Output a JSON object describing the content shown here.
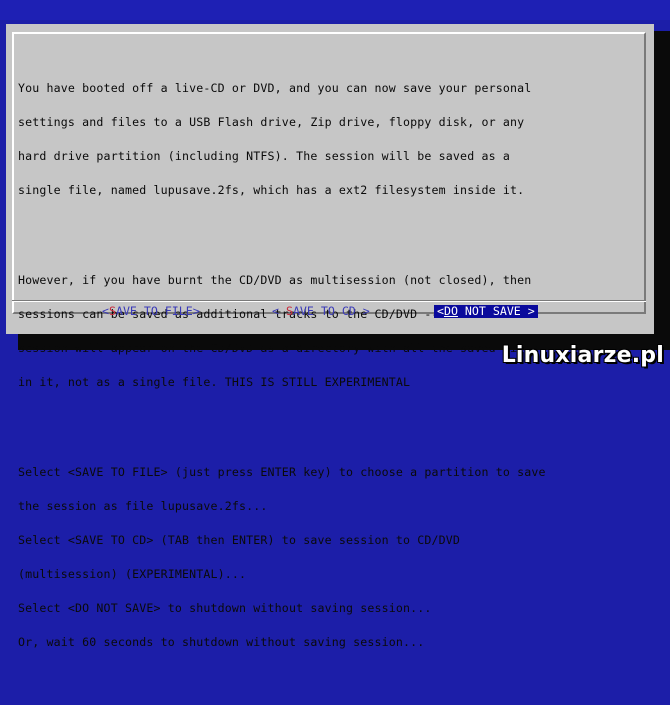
{
  "dialog": {
    "paragraphs": [
      [
        "You have booted off a live-CD or DVD, and you can now save your personal",
        "settings and files to a USB Flash drive, Zip drive, floppy disk, or any",
        "hard drive partition (including NTFS). The session will be saved as a",
        "single file, named lupusave.2fs, which has a ext2 filesystem inside it."
      ],
      [
        "However, if you have burnt the CD/DVD as multisession (not closed), then",
        "sessions can be saved as additional tracks to the CD/DVD -- each saved",
        "session will appear on the CD/DVD as a directory with all the saved files",
        "in it, not as a single file. THIS IS STILL EXPERIMENTAL"
      ],
      [
        "Select <SAVE TO FILE> (just press ENTER key) to choose a partition to save",
        "the session as file lupusave.2fs...",
        "Select <SAVE TO CD> (TAB then ENTER) to save session to CD/DVD",
        "(multisession) (EXPERIMENTAL)...",
        "Select <DO NOT SAVE> to shutdown without saving session...",
        "Or, wait 60 seconds to shutdown without saving session..."
      ]
    ],
    "buttons": {
      "save_to_file": {
        "open": "<",
        "hot": "S",
        "rest": "AVE TO FILE>"
      },
      "save_to_cd": {
        "open": "< ",
        "hot": "S",
        "rest": "AVE TO CD >"
      },
      "do_not_save": {
        "open": "<",
        "hot": "DO",
        "rest": " NOT SAVE >"
      }
    }
  },
  "watermark": "Linuxiarze.pl",
  "colors": {
    "background": "#1c1ea8",
    "dialog": "#c6c6c6",
    "active_button": "#0a0a9c",
    "hotkey": "#c8283a"
  }
}
